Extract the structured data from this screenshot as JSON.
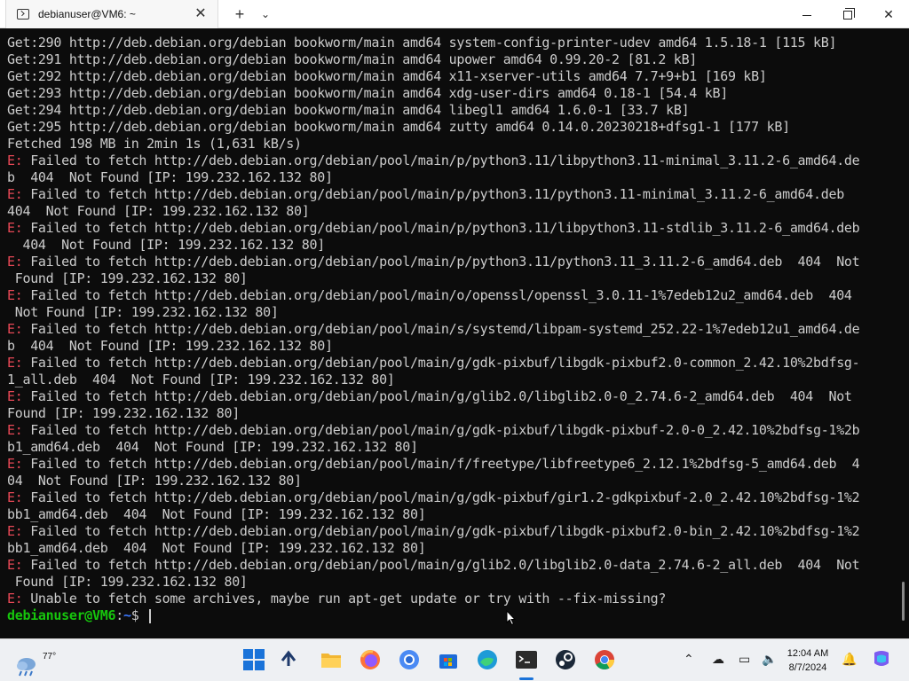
{
  "window": {
    "tab_title": "debianuser@VM6: ~",
    "close_tab": "✕",
    "new_tab": "+",
    "dropdown": "⌄",
    "close_window": "✕"
  },
  "terminal": {
    "lines": [
      {
        "prefix": "",
        "text": "Get:290 http://deb.debian.org/debian bookworm/main amd64 system-config-printer-udev amd64 1.5.18-1 [115 kB]"
      },
      {
        "prefix": "",
        "text": "Get:291 http://deb.debian.org/debian bookworm/main amd64 upower amd64 0.99.20-2 [81.2 kB]"
      },
      {
        "prefix": "",
        "text": "Get:292 http://deb.debian.org/debian bookworm/main amd64 x11-xserver-utils amd64 7.7+9+b1 [169 kB]"
      },
      {
        "prefix": "",
        "text": "Get:293 http://deb.debian.org/debian bookworm/main amd64 xdg-user-dirs amd64 0.18-1 [54.4 kB]"
      },
      {
        "prefix": "",
        "text": "Get:294 http://deb.debian.org/debian bookworm/main amd64 libegl1 amd64 1.6.0-1 [33.7 kB]"
      },
      {
        "prefix": "",
        "text": "Get:295 http://deb.debian.org/debian bookworm/main amd64 zutty amd64 0.14.0.20230218+dfsg1-1 [177 kB]"
      },
      {
        "prefix": "",
        "text": "Fetched 198 MB in 2min 1s (1,631 kB/s)"
      },
      {
        "prefix": "E:",
        "text": " Failed to fetch http://deb.debian.org/debian/pool/main/p/python3.11/libpython3.11-minimal_3.11.2-6_amd64.de"
      },
      {
        "prefix": "",
        "text": "b  404  Not Found [IP: 199.232.162.132 80]"
      },
      {
        "prefix": "E:",
        "text": " Failed to fetch http://deb.debian.org/debian/pool/main/p/python3.11/python3.11-minimal_3.11.2-6_amd64.deb"
      },
      {
        "prefix": "",
        "text": "404  Not Found [IP: 199.232.162.132 80]"
      },
      {
        "prefix": "E:",
        "text": " Failed to fetch http://deb.debian.org/debian/pool/main/p/python3.11/libpython3.11-stdlib_3.11.2-6_amd64.deb"
      },
      {
        "prefix": "",
        "text": "  404  Not Found [IP: 199.232.162.132 80]"
      },
      {
        "prefix": "E:",
        "text": " Failed to fetch http://deb.debian.org/debian/pool/main/p/python3.11/python3.11_3.11.2-6_amd64.deb  404  Not"
      },
      {
        "prefix": "",
        "text": " Found [IP: 199.232.162.132 80]"
      },
      {
        "prefix": "E:",
        "text": " Failed to fetch http://deb.debian.org/debian/pool/main/o/openssl/openssl_3.0.11-1%7edeb12u2_amd64.deb  404"
      },
      {
        "prefix": "",
        "text": " Not Found [IP: 199.232.162.132 80]"
      },
      {
        "prefix": "E:",
        "text": " Failed to fetch http://deb.debian.org/debian/pool/main/s/systemd/libpam-systemd_252.22-1%7edeb12u1_amd64.de"
      },
      {
        "prefix": "",
        "text": "b  404  Not Found [IP: 199.232.162.132 80]"
      },
      {
        "prefix": "E:",
        "text": " Failed to fetch http://deb.debian.org/debian/pool/main/g/gdk-pixbuf/libgdk-pixbuf2.0-common_2.42.10%2bdfsg-"
      },
      {
        "prefix": "",
        "text": "1_all.deb  404  Not Found [IP: 199.232.162.132 80]"
      },
      {
        "prefix": "E:",
        "text": " Failed to fetch http://deb.debian.org/debian/pool/main/g/glib2.0/libglib2.0-0_2.74.6-2_amd64.deb  404  Not"
      },
      {
        "prefix": "",
        "text": "Found [IP: 199.232.162.132 80]"
      },
      {
        "prefix": "E:",
        "text": " Failed to fetch http://deb.debian.org/debian/pool/main/g/gdk-pixbuf/libgdk-pixbuf-2.0-0_2.42.10%2bdfsg-1%2b"
      },
      {
        "prefix": "",
        "text": "b1_amd64.deb  404  Not Found [IP: 199.232.162.132 80]"
      },
      {
        "prefix": "E:",
        "text": " Failed to fetch http://deb.debian.org/debian/pool/main/f/freetype/libfreetype6_2.12.1%2bdfsg-5_amd64.deb  4"
      },
      {
        "prefix": "",
        "text": "04  Not Found [IP: 199.232.162.132 80]"
      },
      {
        "prefix": "E:",
        "text": " Failed to fetch http://deb.debian.org/debian/pool/main/g/gdk-pixbuf/gir1.2-gdkpixbuf-2.0_2.42.10%2bdfsg-1%2"
      },
      {
        "prefix": "",
        "text": "bb1_amd64.deb  404  Not Found [IP: 199.232.162.132 80]"
      },
      {
        "prefix": "E:",
        "text": " Failed to fetch http://deb.debian.org/debian/pool/main/g/gdk-pixbuf/libgdk-pixbuf2.0-bin_2.42.10%2bdfsg-1%2"
      },
      {
        "prefix": "",
        "text": "bb1_amd64.deb  404  Not Found [IP: 199.232.162.132 80]"
      },
      {
        "prefix": "E:",
        "text": " Failed to fetch http://deb.debian.org/debian/pool/main/g/glib2.0/libglib2.0-data_2.74.6-2_all.deb  404  Not"
      },
      {
        "prefix": "",
        "text": " Found [IP: 199.232.162.132 80]"
      },
      {
        "prefix": "E:",
        "text": " Unable to fetch some archives, maybe run apt-get update or try with --fix-missing?"
      }
    ],
    "prompt": {
      "user_host": "debianuser@VM6",
      "sep": ":",
      "path": "~",
      "symbol": "$ "
    }
  },
  "taskbar": {
    "weather_temp": "77°",
    "time": "12:04 AM",
    "date": "8/7/2024",
    "icons": [
      "start-icon",
      "app-icon",
      "file-explorer-icon",
      "firefox-icon",
      "chromium-icon",
      "store-icon",
      "edge-icon",
      "terminal-icon",
      "steam-icon",
      "chrome-icon"
    ]
  },
  "colors": {
    "terminal_bg": "#0c0c0c",
    "terminal_fg": "#cccccc",
    "error": "#e74856",
    "prompt_user": "#16c60c",
    "prompt_path": "#3b78ff"
  }
}
